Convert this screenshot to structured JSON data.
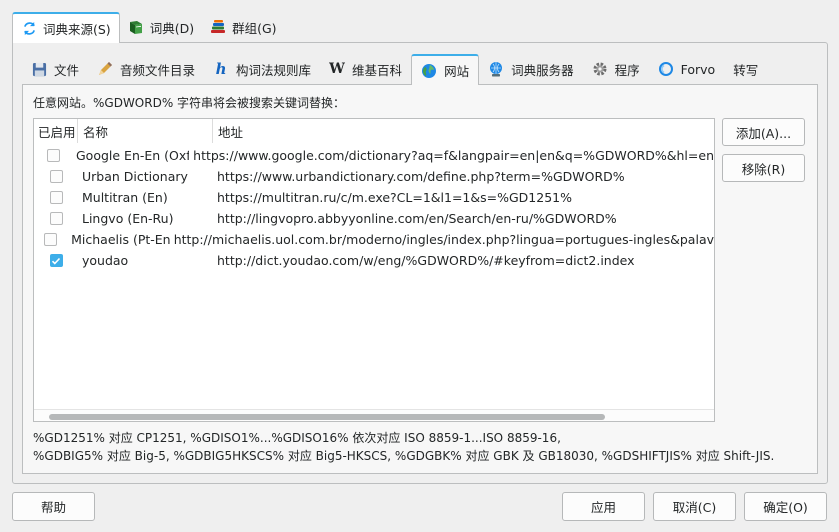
{
  "top_tabs": [
    {
      "label": "词典来源(S)",
      "icon": "refresh-icon",
      "active": true
    },
    {
      "label": "词典(D)",
      "icon": "book-icon",
      "active": false
    },
    {
      "label": "群组(G)",
      "icon": "books-stack-icon",
      "active": false
    }
  ],
  "sub_tabs": [
    {
      "label": "文件",
      "icon": "save-icon"
    },
    {
      "label": "音频文件目录",
      "icon": "pencil-icon"
    },
    {
      "label": "构词法规则库",
      "icon": "hunspell-icon"
    },
    {
      "label": "维基百科",
      "icon": "wikipedia-icon"
    },
    {
      "label": "网站",
      "icon": "globe-icon"
    },
    {
      "label": "词典服务器",
      "icon": "network-icon"
    },
    {
      "label": "程序",
      "icon": "gear-icon"
    },
    {
      "label": "Forvo",
      "icon": "forvo-icon"
    },
    {
      "label": "转写",
      "icon": ""
    }
  ],
  "description": "任意网站。%GDWORD% 字符串将会被搜索关键词替换：",
  "table": {
    "headers": [
      "已启用",
      "名称",
      "地址"
    ],
    "rows": [
      {
        "enabled": false,
        "name": "Google En-En (Oxford)",
        "address": "https://www.google.com/dictionary?aq=f&langpair=en|en&q=%GDWORD%&hl=en"
      },
      {
        "enabled": false,
        "name": "Urban Dictionary",
        "address": "https://www.urbandictionary.com/define.php?term=%GDWORD%"
      },
      {
        "enabled": false,
        "name": "Multitran (En)",
        "address": "https://multitran.ru/c/m.exe?CL=1&l1=1&s=%GD1251%"
      },
      {
        "enabled": false,
        "name": "Lingvo (En-Ru)",
        "address": "http://lingvopro.abbyyonline.com/en/Search/en-ru/%GDWORD%"
      },
      {
        "enabled": false,
        "name": "Michaelis (Pt-En)",
        "address": "http://michaelis.uol.com.br/moderno/ingles/index.php?lingua=portugues-ingles&palav"
      },
      {
        "enabled": true,
        "name": "youdao",
        "address": "http://dict.youdao.com/w/eng/%GDWORD%/#keyfrom=dict2.index"
      }
    ]
  },
  "side_buttons": {
    "add": "添加(A)...",
    "remove": "移除(R)"
  },
  "notes": [
    "%GD1251% 对应 CP1251, %GDISO1%...%GDISO16% 依次对应 ISO 8859-1...ISO 8859-16,",
    "%GDBIG5% 对应 Big-5, %GDBIG5HKSCS% 对应 Big5-HKSCS, %GDGBK% 对应 GBK 及 GB18030, %GDSHIFTJIS% 对应 Shift-JIS."
  ],
  "bottom_buttons": {
    "help": "帮助",
    "apply": "应用",
    "cancel": "取消(C)",
    "ok": "确定(O)"
  },
  "colors": {
    "accent": "#3daee9",
    "border": "#bcbebf"
  }
}
